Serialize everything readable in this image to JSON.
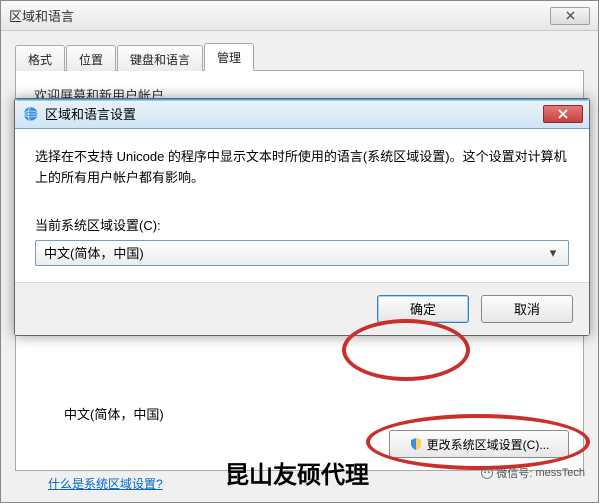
{
  "parent": {
    "title": "区域和语言",
    "tabs": [
      "格式",
      "位置",
      "键盘和语言",
      "管理"
    ],
    "active_tab_index": 3,
    "welcome_truncated": "欢迎屏幕和新用户帐户",
    "current_locale_text": "中文(简体，中国)",
    "change_button": "更改系统区域设置(C)...",
    "link": "什么是系统区域设置?"
  },
  "dialog": {
    "title": "区域和语言设置",
    "description": "选择在不支持 Unicode 的程序中显示文本时所使用的语言(系统区域设置)。这个设置对计算机上的所有用户帐户都有影响。",
    "label": "当前系统区域设置(C):",
    "selected_option": "中文(简体，中国)",
    "ok": "确定",
    "cancel": "取消"
  },
  "watermark": {
    "large": "昆山友硕代理",
    "small_prefix": "微信号:",
    "small_id": "messTech"
  },
  "icons": {
    "globe": "globe-icon",
    "shield": "shield-icon",
    "close": "close-icon",
    "chevron": "▾"
  }
}
